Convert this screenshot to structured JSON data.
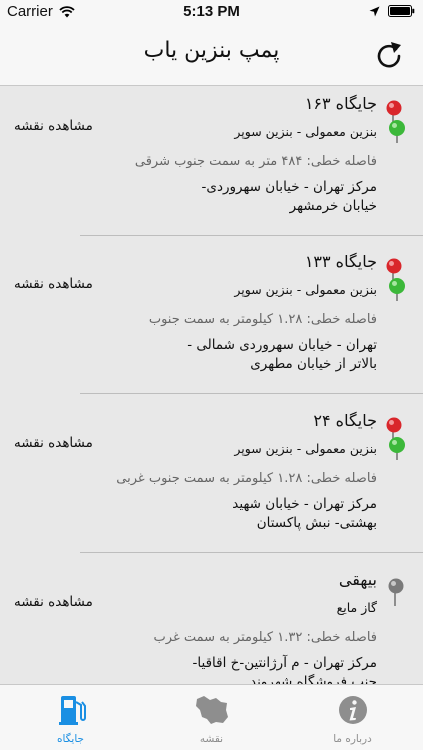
{
  "status_bar": {
    "carrier": "Carrier",
    "time": "5:13 PM"
  },
  "nav": {
    "title": "پمپ بنزین یاب"
  },
  "stations": [
    {
      "title": "جایگاه ۱۶۳",
      "fuel": "بنزین معمولی - بنزین سوپر",
      "distance": "فاصله خطی: ۴۸۴  متر به سمت جنوب شرقی",
      "address": "مرکز تهران - خیابان سهروردی- خیابان خرمشهر",
      "map_link": "مشاهده نقشه",
      "pin": "red-green"
    },
    {
      "title": "جایگاه ۱۳۳",
      "fuel": "بنزین معمولی - بنزین سوپر",
      "distance": "فاصله خطی: ۱.۲۸ کیلومتر به سمت جنوب",
      "address": "تهران - خیابان سهروردی شمالی - بالاتر از خیابان مطهری",
      "map_link": "مشاهده نقشه",
      "pin": "red-green"
    },
    {
      "title": "جایگاه ۲۴",
      "fuel": "بنزین معمولی - بنزین سوپر",
      "distance": "فاصله خطی: ۱.۲۸ کیلومتر به سمت جنوب غربی",
      "address": "مرکز تهران - خیابان شهید بهشتی- نبش پاکستان",
      "map_link": "مشاهده نقشه",
      "pin": "red-green"
    },
    {
      "title": "بیهقی",
      "fuel": "گاز مایع",
      "distance": "فاصله خطی: ۱.۳۲ کیلومتر به سمت غرب",
      "address": "مرکز تهران - م آرژانتین-خ اقاقیا-جنب فروشگاه شهروند",
      "map_link": "مشاهده نقشه",
      "pin": "gray"
    }
  ],
  "tabs": [
    {
      "label": "جایگاه",
      "icon": "fuel-pump-icon",
      "active": true
    },
    {
      "label": "نقشه",
      "icon": "iran-map-icon",
      "active": false
    },
    {
      "label": "درباره ما",
      "icon": "info-icon",
      "active": false
    }
  ],
  "colors": {
    "accent": "#1a8fe3",
    "inactive": "#8e8e8e",
    "pin_red": "#d9262b",
    "pin_green": "#3cb83a"
  }
}
